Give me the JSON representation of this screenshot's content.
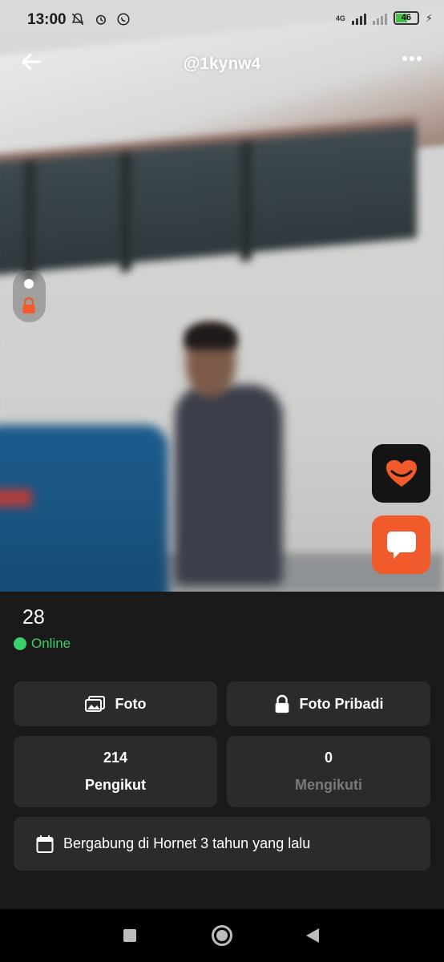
{
  "status_bar": {
    "time": "13:00",
    "left_icons": [
      "bell-off-icon",
      "alarm-icon",
      "whatsapp-icon"
    ],
    "network_label": "4G",
    "battery_level": "46"
  },
  "header": {
    "title": "@1kynw4",
    "back_icon": "arrow-left-icon",
    "more_icon": "more-dots-icon"
  },
  "profile": {
    "age": "28",
    "status": "Online",
    "status_color": "#3ad06a"
  },
  "actions": {
    "photos_label": "Foto",
    "private_photos_label": "Foto Pribadi"
  },
  "stats": {
    "followers_count": "214",
    "followers_label": "Pengikut",
    "following_count": "0",
    "following_label": "Mengikuti"
  },
  "joined": {
    "text": "Bergabung di Hornet 3 tahun yang lalu"
  },
  "colors": {
    "accent": "#f15a2b",
    "panel_bg": "#1a1a1a",
    "card_bg": "#2b2b2b"
  }
}
